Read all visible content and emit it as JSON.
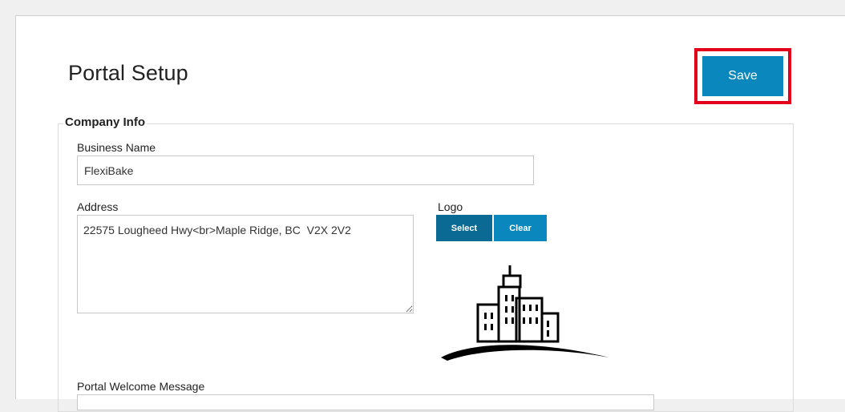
{
  "page": {
    "title": "Portal Setup",
    "save_label": "Save"
  },
  "company_info": {
    "legend": "Company Info",
    "business_name_label": "Business Name",
    "business_name_value": "FlexiBake",
    "address_label": "Address",
    "address_value": "22575 Lougheed Hwy<br>Maple Ridge, BC  V2X 2V2",
    "logo_label": "Logo",
    "logo_select_label": "Select",
    "logo_clear_label": "Clear",
    "logo_icon": "city-skyline-logo",
    "welcome_message_label": "Portal Welcome Message"
  },
  "colors": {
    "accent": "#0a88bd",
    "accent_dark": "#0a6a94",
    "highlight": "#e3001b"
  }
}
